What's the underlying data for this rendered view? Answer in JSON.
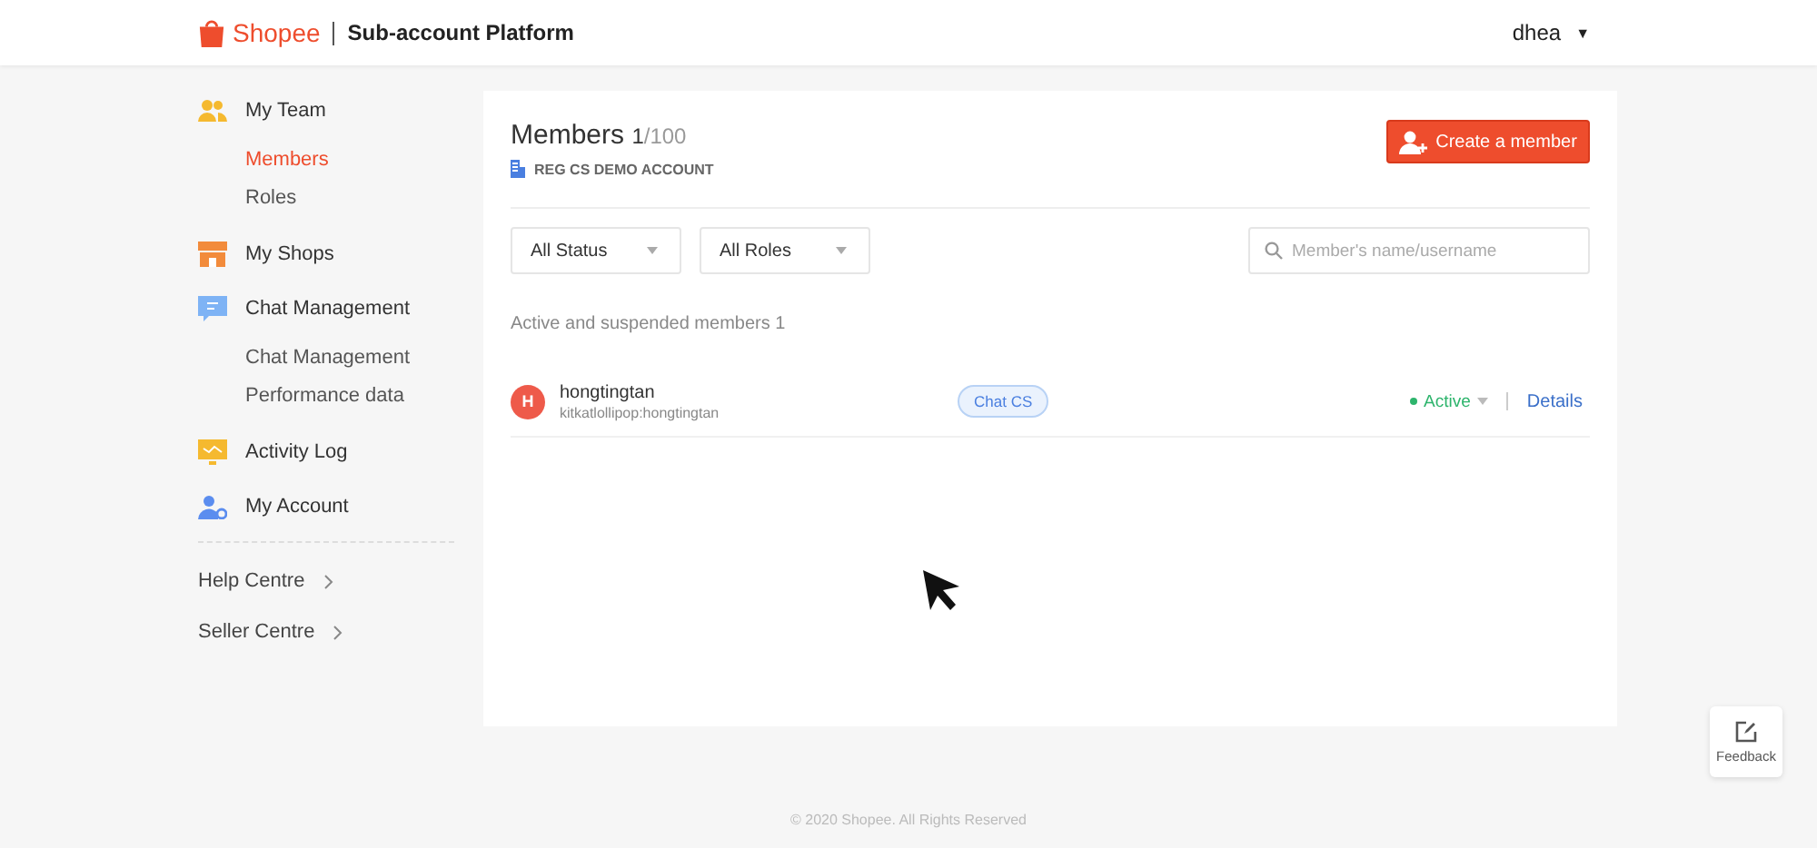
{
  "header": {
    "brand": "Shopee",
    "platform": "Sub-account Platform",
    "user": "dhea",
    "user_caret": "▼"
  },
  "sidebar": {
    "items": [
      {
        "label": "My Team",
        "selected": false,
        "children": [
          {
            "label": "Members",
            "selected": true
          },
          {
            "label": "Roles",
            "selected": false
          }
        ]
      },
      {
        "label": "My Shops",
        "selected": false
      },
      {
        "label": "Chat Management",
        "selected": false,
        "children": [
          {
            "label": "Chat Management",
            "selected": false
          },
          {
            "label": "Performance data",
            "selected": false
          }
        ]
      },
      {
        "label": "Activity Log",
        "selected": false
      },
      {
        "label": "My Account",
        "selected": false
      }
    ],
    "links": [
      {
        "label": "Help Centre"
      },
      {
        "label": "Seller Centre"
      }
    ]
  },
  "main": {
    "title": "Members",
    "count": "1",
    "limit": "/100",
    "account": "REG CS DEMO ACCOUNT",
    "create_button": "Create a member",
    "filters": [
      {
        "value": "All Status"
      },
      {
        "value": "All Roles"
      }
    ],
    "search": {
      "placeholder": "Member's name/username"
    },
    "summary": "Active and suspended members 1",
    "members": [
      {
        "initial": "H",
        "name": "hongtingtan",
        "username": "kitkatlollipop:hongtingtan",
        "role": "Chat CS",
        "status": "Active",
        "color": "#2db46c",
        "action": "Details"
      }
    ]
  },
  "feedback": "Feedback",
  "footer": "© 2020 Shopee. All Rights Reserved"
}
